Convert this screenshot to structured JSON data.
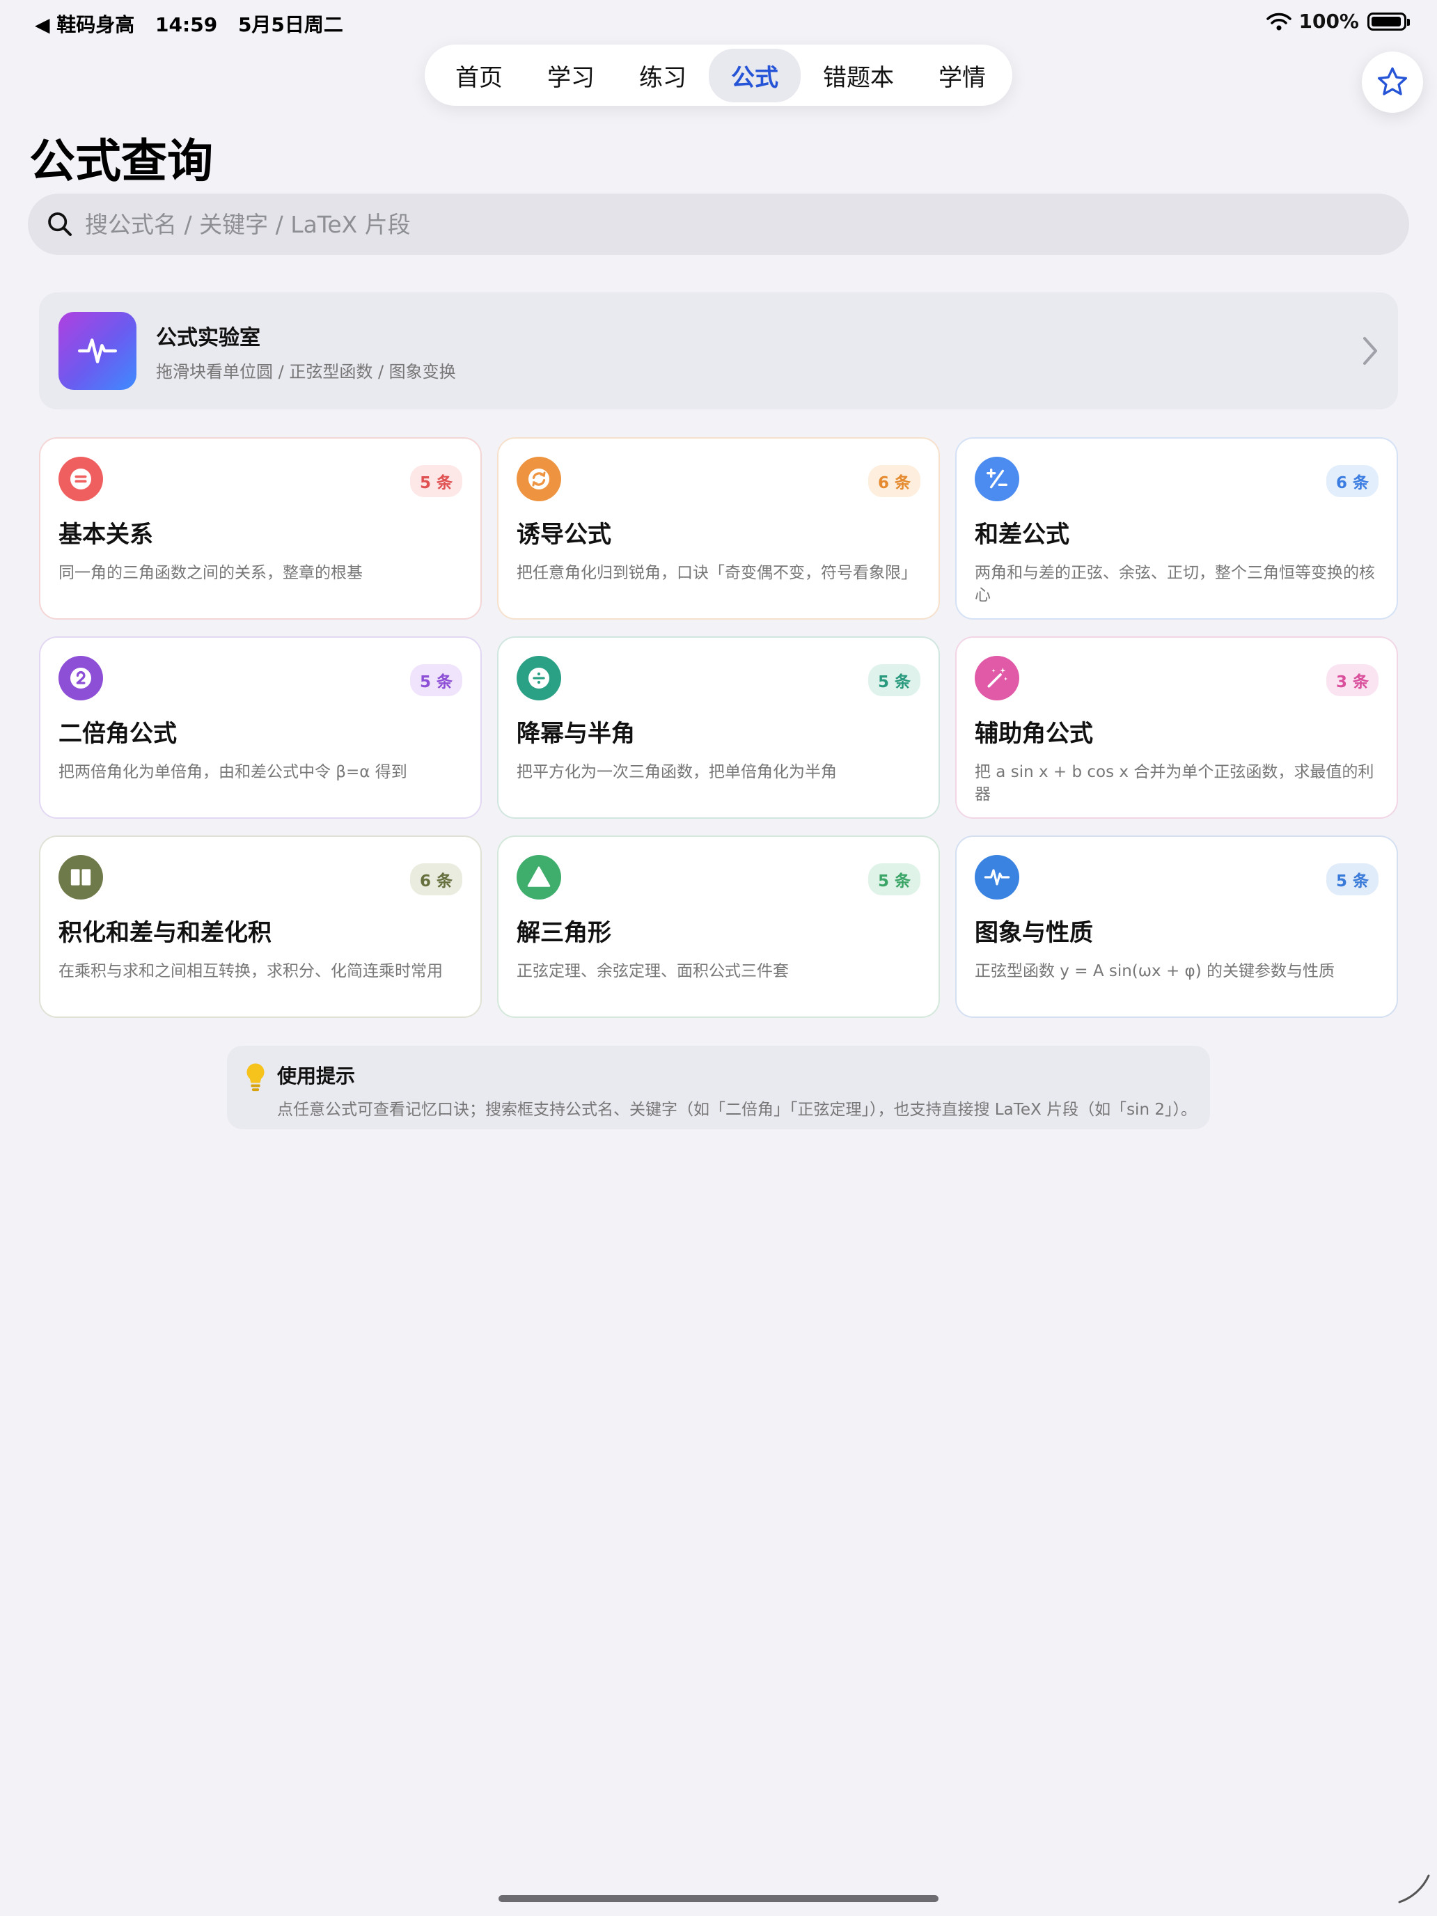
{
  "status_bar": {
    "back_app": "◀ 鞋码身高",
    "time": "14:59",
    "date": "5月5日周二",
    "battery": "100%",
    "battery_level": 0.98
  },
  "tabs": [
    {
      "label": "首页",
      "active": false
    },
    {
      "label": "学习",
      "active": false
    },
    {
      "label": "练习",
      "active": false
    },
    {
      "label": "公式",
      "active": true
    },
    {
      "label": "错题本",
      "active": false
    },
    {
      "label": "学情",
      "active": false
    }
  ],
  "header": {
    "title": "公式查询",
    "favorite_icon": "star-icon"
  },
  "search": {
    "placeholder": "搜公式名 / 关键字 / LaTeX 片段",
    "value": ""
  },
  "lab": {
    "title": "公式实验室",
    "subtitle": "拖滑块看单位圆 / 正弦型函数 / 图象变换",
    "icon": "waveform-icon"
  },
  "categories": [
    {
      "title": "基本关系",
      "count": "5 条",
      "desc": "同一角的三角函数之间的关系，整章的根基",
      "icon": "equals-icon",
      "color": "#ef5f5f",
      "badge_bg": "#fde7e7",
      "border": "#f5d6d6"
    },
    {
      "title": "诱导公式",
      "count": "6 条",
      "desc": "把任意角化归到锐角，口诀「奇变偶不变，符号看象限」",
      "icon": "cycle-icon",
      "color": "#ee9440",
      "badge_bg": "#fdeedd",
      "border": "#f6e1cc"
    },
    {
      "title": "和差公式",
      "count": "6 条",
      "desc": "两角和与差的正弦、余弦、正切，整个三角恒等变换的核心",
      "icon": "plus-minus-icon",
      "color": "#4c8cf0",
      "badge_bg": "#e3eefd",
      "border": "#d5e2f6"
    },
    {
      "title": "二倍角公式",
      "count": "5 条",
      "desc": "把两倍角化为单倍角，由和差公式中令 β=α 得到",
      "icon": "number-two-icon",
      "color": "#8d4fd6",
      "badge_bg": "#efe4fb",
      "border": "#e3d8f3"
    },
    {
      "title": "降幂与半角",
      "count": "5 条",
      "desc": "把平方化为一次三角函数，把单倍角化为半角",
      "icon": "divide-icon",
      "color": "#2aa085",
      "badge_bg": "#dff3ec",
      "border": "#d2e6e0"
    },
    {
      "title": "辅助角公式",
      "count": "3 条",
      "desc": "把 a sin x + b cos x 合并为单个正弦函数，求最值的利器",
      "icon": "magic-wand-icon",
      "color": "#e05aa8",
      "badge_bg": "#fbe4f1",
      "border": "#f2d6e6"
    },
    {
      "title": "积化和差与和差化积",
      "count": "6 条",
      "desc": "在乘积与求和之间相互转换，求积分、化简连乘时常用",
      "icon": "book-icon",
      "color": "#6f7a4a",
      "badge_bg": "#eaecdf",
      "border": "#e0e2d6"
    },
    {
      "title": "解三角形",
      "count": "5 条",
      "desc": "正弦定理、余弦定理、面积公式三件套",
      "icon": "triangle-icon",
      "color": "#3fae6d",
      "badge_bg": "#e0f3e8",
      "border": "#d4e8dc"
    },
    {
      "title": "图象与性质",
      "count": "5 条",
      "desc": "正弦型函数 y = A sin(ωx + φ) 的关键参数与性质",
      "icon": "waveform-icon",
      "color": "#3a83e0",
      "badge_bg": "#e1ecfb",
      "border": "#d4e0f2"
    }
  ],
  "tip": {
    "title": "使用提示",
    "text": "点任意公式可查看记忆口诀；搜索框支持公式名、关键字（如「二倍角」「正弦定理」），也支持直接搜 LaTeX 片段（如「sin 2」）。",
    "icon": "lightbulb-icon"
  }
}
